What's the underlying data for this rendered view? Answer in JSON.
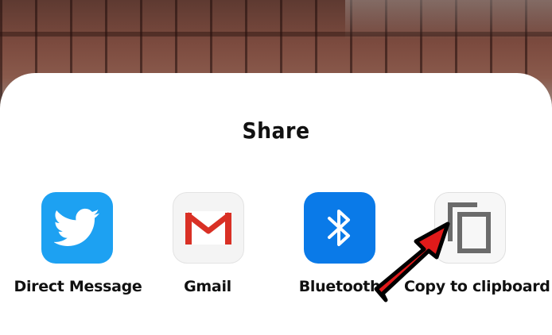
{
  "share_sheet": {
    "title": "Share",
    "targets": [
      {
        "label": "Direct Message",
        "icon": "twitter-bird-icon",
        "color": "#1da1f2"
      },
      {
        "label": "Gmail",
        "icon": "gmail-envelope-icon",
        "color": "#d93025"
      },
      {
        "label": "Bluetooth",
        "icon": "bluetooth-icon",
        "color": "#0a7ae8"
      },
      {
        "label": "Copy to clipboard",
        "icon": "copy-icon",
        "color": "#6b6b6b"
      }
    ]
  },
  "annotation": {
    "icon": "red-arrow-pointer",
    "color": "#e11a1a"
  }
}
